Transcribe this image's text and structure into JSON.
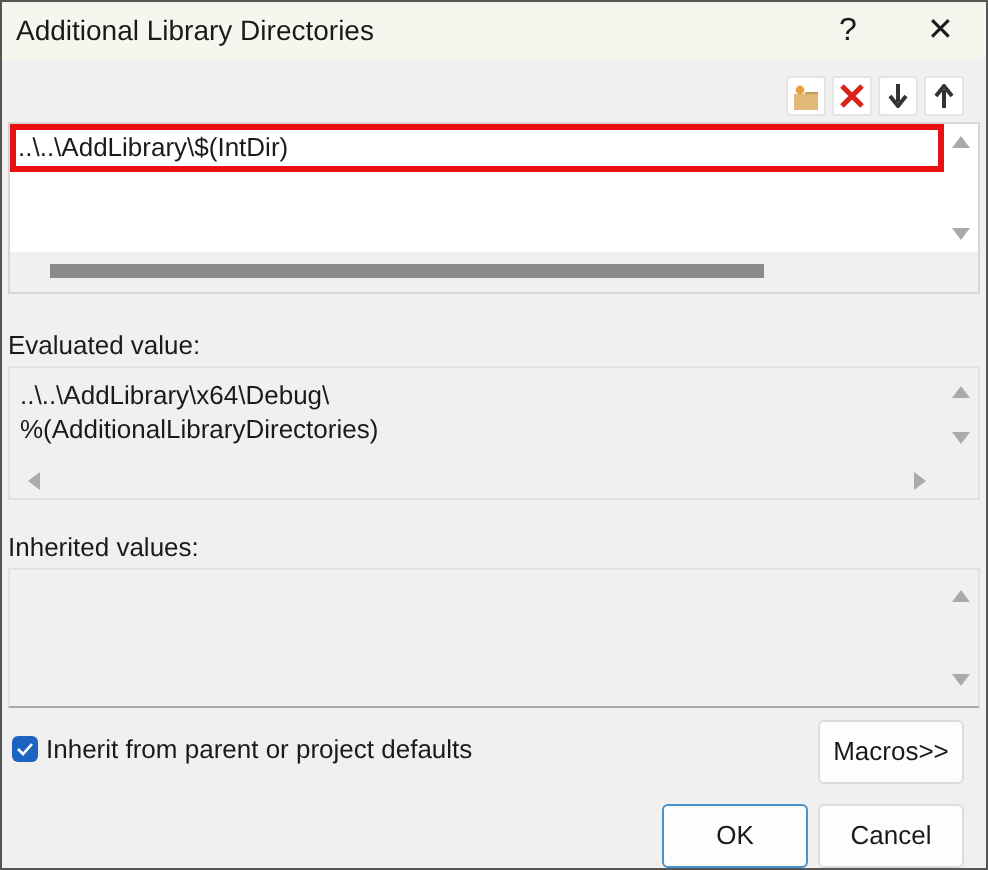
{
  "window": {
    "title": "Additional Library Directories",
    "help": "?",
    "close": "✕"
  },
  "toolbar": [
    {
      "kind": "new"
    },
    {
      "kind": "delete"
    },
    {
      "kind": "down"
    },
    {
      "kind": "up"
    }
  ],
  "entries": [
    {
      "text": "..\\..\\AddLibrary\\$(IntDir)",
      "highlighted": true
    }
  ],
  "evaluated": {
    "label": "Evaluated value:",
    "lines": [
      "..\\..\\AddLibrary\\x64\\Debug\\",
      "%(AdditionalLibraryDirectories)"
    ]
  },
  "inherited": {
    "label": "Inherited values:"
  },
  "inherit_checkbox": {
    "label": "Inherit from parent or project defaults",
    "checked": true
  },
  "buttons": [
    {
      "label": "Macros>>",
      "kind": "macros"
    },
    {
      "label": "OK",
      "kind": "ok",
      "default": true
    },
    {
      "label": "Cancel",
      "kind": "cancel",
      "default": false
    }
  ]
}
